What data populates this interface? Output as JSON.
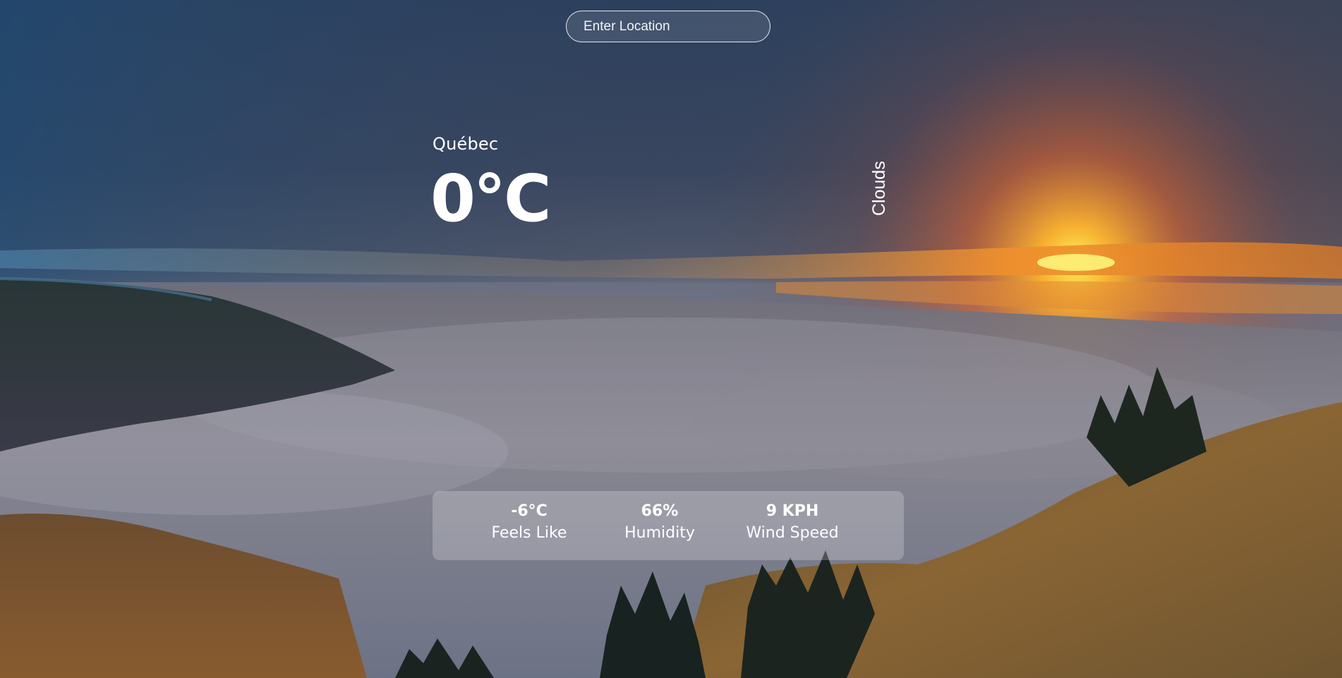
{
  "search": {
    "placeholder": "Enter Location",
    "value": ""
  },
  "weather": {
    "city": "Québec",
    "temperature": "0°C",
    "condition": "Clouds"
  },
  "stats": {
    "feels_like": {
      "value": "-6°C",
      "label": "Feels Like"
    },
    "humidity": {
      "value": "66%",
      "label": "Humidity"
    },
    "wind_speed": {
      "value": "9 KPH",
      "label": "Wind Speed"
    }
  },
  "background": {
    "description_icon": "sunset-over-clouds-background",
    "colors": {
      "sky_top": "#2d4769",
      "sky_right": "#4a4b5e",
      "sunset": "#f0a43a",
      "sun": "#ffe24a",
      "fog": "#8b8f9e",
      "forest": "#1f2a28",
      "hill": "#7a5a2f"
    }
  }
}
